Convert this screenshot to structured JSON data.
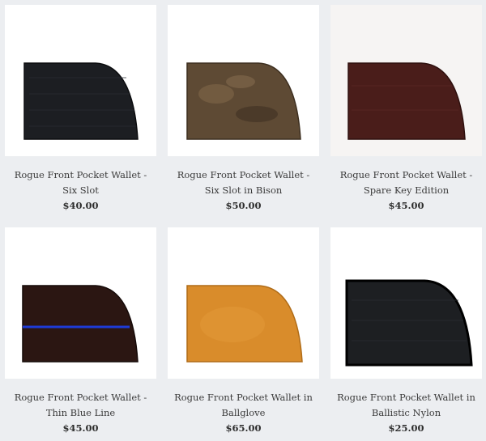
{
  "products": [
    {
      "name": "Rogue Front Pocket Wallet - Six Slot",
      "price": "$40.00",
      "color": "#1c1e22"
    },
    {
      "name": "Rogue Front Pocket Wallet - Six Slot in Bison",
      "price": "$50.00",
      "color": "#5e4a34"
    },
    {
      "name": "Rogue Front Pocket Wallet - Spare Key Edition",
      "price": "$45.00",
      "color": "#4a1d1a"
    },
    {
      "name": "Rogue Front Pocket Wallet - Thin Blue Line",
      "price": "$45.00",
      "color": "#2b1612"
    },
    {
      "name": "Rogue Front Pocket Wallet in Ballglove",
      "price": "$65.00",
      "color": "#d98c2b"
    },
    {
      "name": "Rogue Front Pocket Wallet in Ballistic Nylon",
      "price": "$25.00",
      "color": "#1d1f22"
    }
  ]
}
